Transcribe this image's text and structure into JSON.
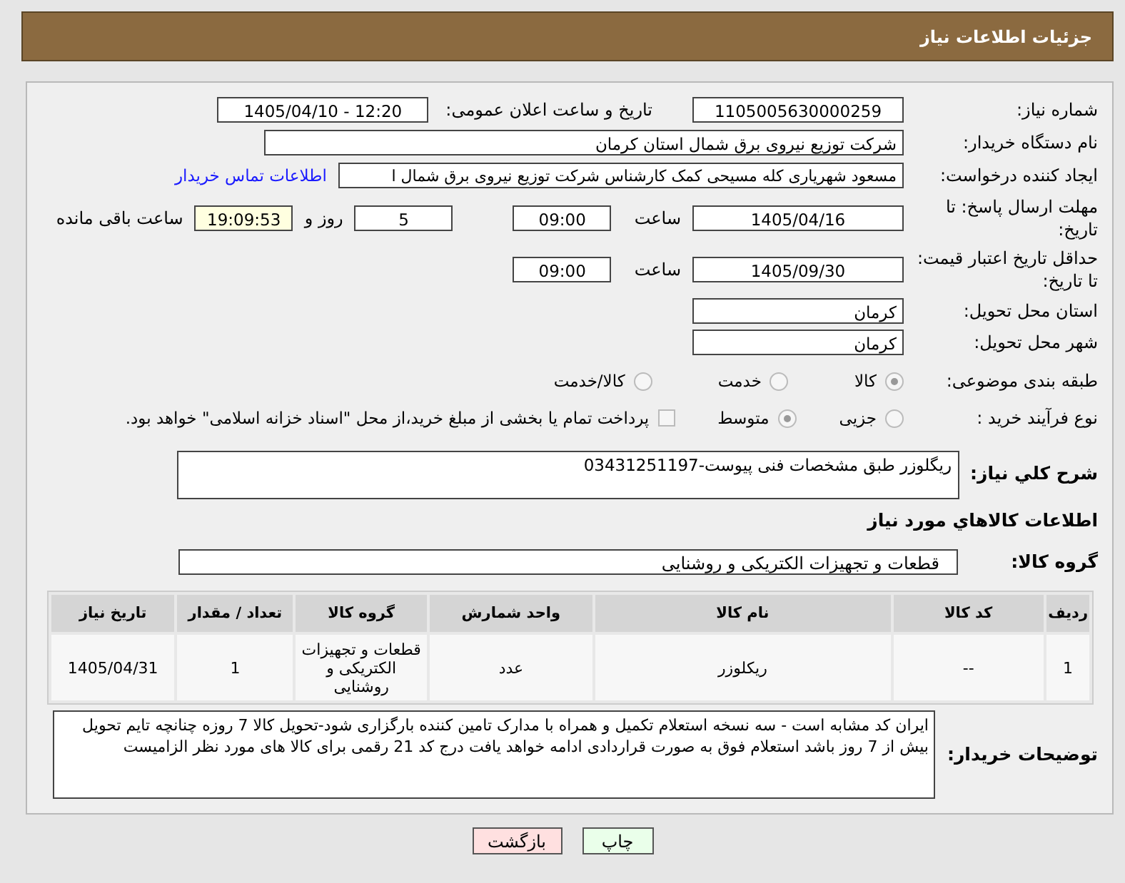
{
  "header": {
    "title": "جزئیات اطلاعات نیاز"
  },
  "need_number": {
    "label": "شماره نیاز:",
    "value": "1105005630000259"
  },
  "announce": {
    "label": "تاریخ و ساعت اعلان عمومی:",
    "value": "1405/04/10 - 12:20"
  },
  "buyer": {
    "label": "نام دستگاه خریدار:",
    "value": "شرکت توزیع نیروی برق شمال استان کرمان"
  },
  "requester": {
    "label": "ایجاد کننده درخواست:",
    "value": "مسعود شهریاری کله مسیحی کمک کارشناس شرکت توزیع نیروی برق شمال ا",
    "link": "اطلاعات تماس خریدار"
  },
  "deadline": {
    "label": "مهلت ارسال پاسخ: تا تاریخ:",
    "date": "1405/04/16",
    "time_label": "ساعت",
    "time": "09:00",
    "days": "5",
    "days_label": "روز و",
    "remaining": "19:09:53",
    "remaining_label": "ساعت باقی مانده"
  },
  "validity": {
    "label": "حداقل تاریخ اعتبار قیمت: تا تاریخ:",
    "date": "1405/09/30",
    "time_label": "ساعت",
    "time": "09:00"
  },
  "province": {
    "label": "استان محل تحویل:",
    "value": "کرمان"
  },
  "city": {
    "label": "شهر محل تحویل:",
    "value": "کرمان"
  },
  "category": {
    "label": "طبقه بندی موضوعی:",
    "options": [
      {
        "label": "کالا",
        "selected": true
      },
      {
        "label": "خدمت",
        "selected": false
      },
      {
        "label": "کالا/خدمت",
        "selected": false
      }
    ]
  },
  "process": {
    "label": "نوع فرآیند خرید :",
    "options": [
      {
        "label": "جزیی",
        "selected": false
      },
      {
        "label": "متوسط",
        "selected": true
      }
    ],
    "checkbox": {
      "label": "پرداخت تمام یا بخشی از مبلغ خرید،از محل \"اسناد خزانه اسلامی\" خواهد بود.",
      "checked": false
    }
  },
  "description": {
    "label": "شرح کلي نياز:",
    "value": "ریگلوزر طبق مشخصات فنی پیوست-03431251197"
  },
  "goods_title": "اطلاعات کالاهاي مورد نياز",
  "group": {
    "label": "گروه کالا:",
    "value": "قطعات و تجهیزات الکتریکی و روشنایی"
  },
  "table": {
    "columns": [
      "ردیف",
      "کد کالا",
      "نام کالا",
      "واحد شمارش",
      "گروه کالا",
      "تعداد / مقدار",
      "تاریخ نیاز"
    ],
    "rows": [
      [
        "1",
        "--",
        "ریکلوزر",
        "عدد",
        "قطعات و تجهیزات الکتریکی و روشنایی",
        "1",
        "1405/04/31"
      ]
    ]
  },
  "buyer_notes": {
    "label": "توضیحات خریدار:",
    "value": "ایران کد مشابه است - سه نسخه استعلام تکمیل و همراه با مدارک تامین کننده بارگزاری شود-تحویل کالا 7 روزه چنانچه تایم تحویل بیش از 7 روز باشد استعلام فوق به صورت قراردادی ادامه خواهد یافت  درج کد 21 رقمی برای کالا های مورد نظر الزامیست"
  },
  "buttons": [
    {
      "label": "چاپ",
      "kind": "print"
    },
    {
      "label": "بازگشت",
      "kind": "back"
    }
  ]
}
